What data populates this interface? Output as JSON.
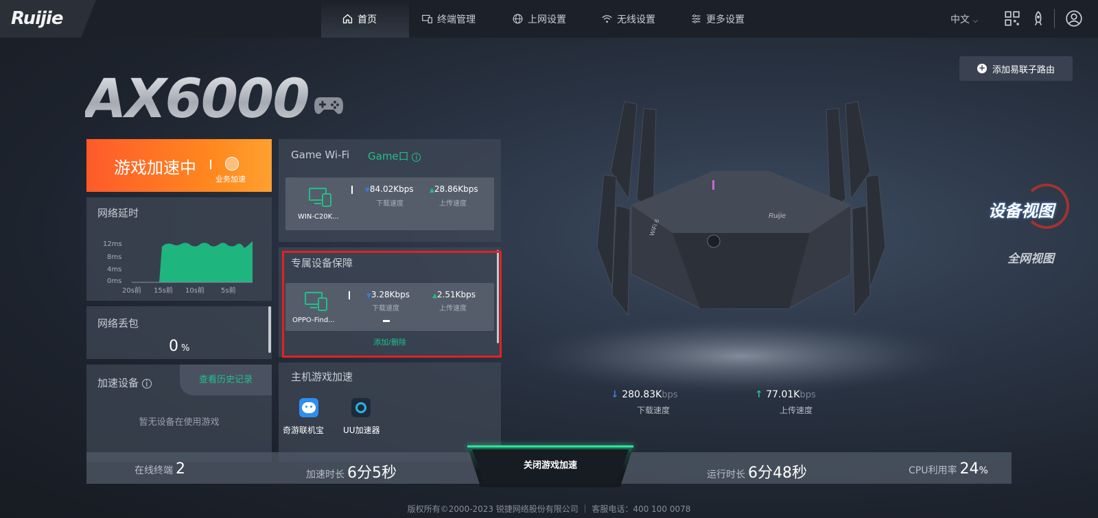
{
  "header": {
    "logo": "Ruijie",
    "nav": [
      {
        "label": "首页",
        "icon": "home-icon"
      },
      {
        "label": "终端管理",
        "icon": "devices-icon"
      },
      {
        "label": "上网设置",
        "icon": "globe-icon"
      },
      {
        "label": "无线设置",
        "icon": "wifi-icon"
      },
      {
        "label": "更多设置",
        "icon": "sliders-icon"
      }
    ],
    "lang": "中文",
    "icons": [
      "qrcode-icon",
      "rocket-icon",
      "user-icon"
    ]
  },
  "model": "AX6000",
  "add_router": "添加易联子路由",
  "boost": {
    "status": "游戏加速中",
    "sub": "业务加速"
  },
  "latency": {
    "title": "网络延时",
    "y_ticks": [
      "12ms",
      "8ms",
      "4ms",
      "0ms"
    ],
    "x_ticks": [
      "20s前",
      "15s前",
      "10s前",
      "5s前"
    ]
  },
  "loss": {
    "title": "网络丢包",
    "value": "0",
    "unit": "%"
  },
  "accel": {
    "title": "加速设备",
    "history": "查看历史记录",
    "empty": "暂无设备在使用游戏"
  },
  "game_wifi": {
    "title": "Game Wi-Fi",
    "port": "Game口",
    "device": "WIN-C20K...",
    "down": "84.02Kbps",
    "down_label": "下载速度",
    "up": "28.86Kbps",
    "up_label": "上传速度"
  },
  "exclusive": {
    "title": "专属设备保障",
    "device": "OPPO-Find...",
    "down": "3.28Kbps",
    "down_label": "下载速度",
    "up": "2.51Kbps",
    "up_label": "上传速度",
    "action": "添加/删除"
  },
  "console": {
    "title": "主机游戏加速",
    "apps": [
      {
        "label": "奇游联机宝"
      },
      {
        "label": "UU加速器"
      }
    ]
  },
  "router_rates": {
    "down_value": "280.83K",
    "down_unit": "bps",
    "down_label": "下载速度",
    "up_value": "77.01K",
    "up_unit": "bps",
    "up_label": "上传速度"
  },
  "views": {
    "active": "设备视图",
    "inactive": "全网视图"
  },
  "stats": {
    "online_label": "在线终端",
    "online_value": "2",
    "accel_time_label": "加速时长",
    "accel_time_value": "6分5秒",
    "stop_button": "关闭游戏加速",
    "uptime_label": "运行时长",
    "uptime_value": "6分48秒",
    "cpu_label": "CPU利用率",
    "cpu_value": "24",
    "cpu_unit": "%"
  },
  "footer": "版权所有©2000-2023 锐捷网络股份有限公司 ｜ 客服电话：400 100 0078",
  "colors": {
    "accent": "#1fc08a",
    "boost": "#ff6a24",
    "highlight": "#e02323"
  }
}
